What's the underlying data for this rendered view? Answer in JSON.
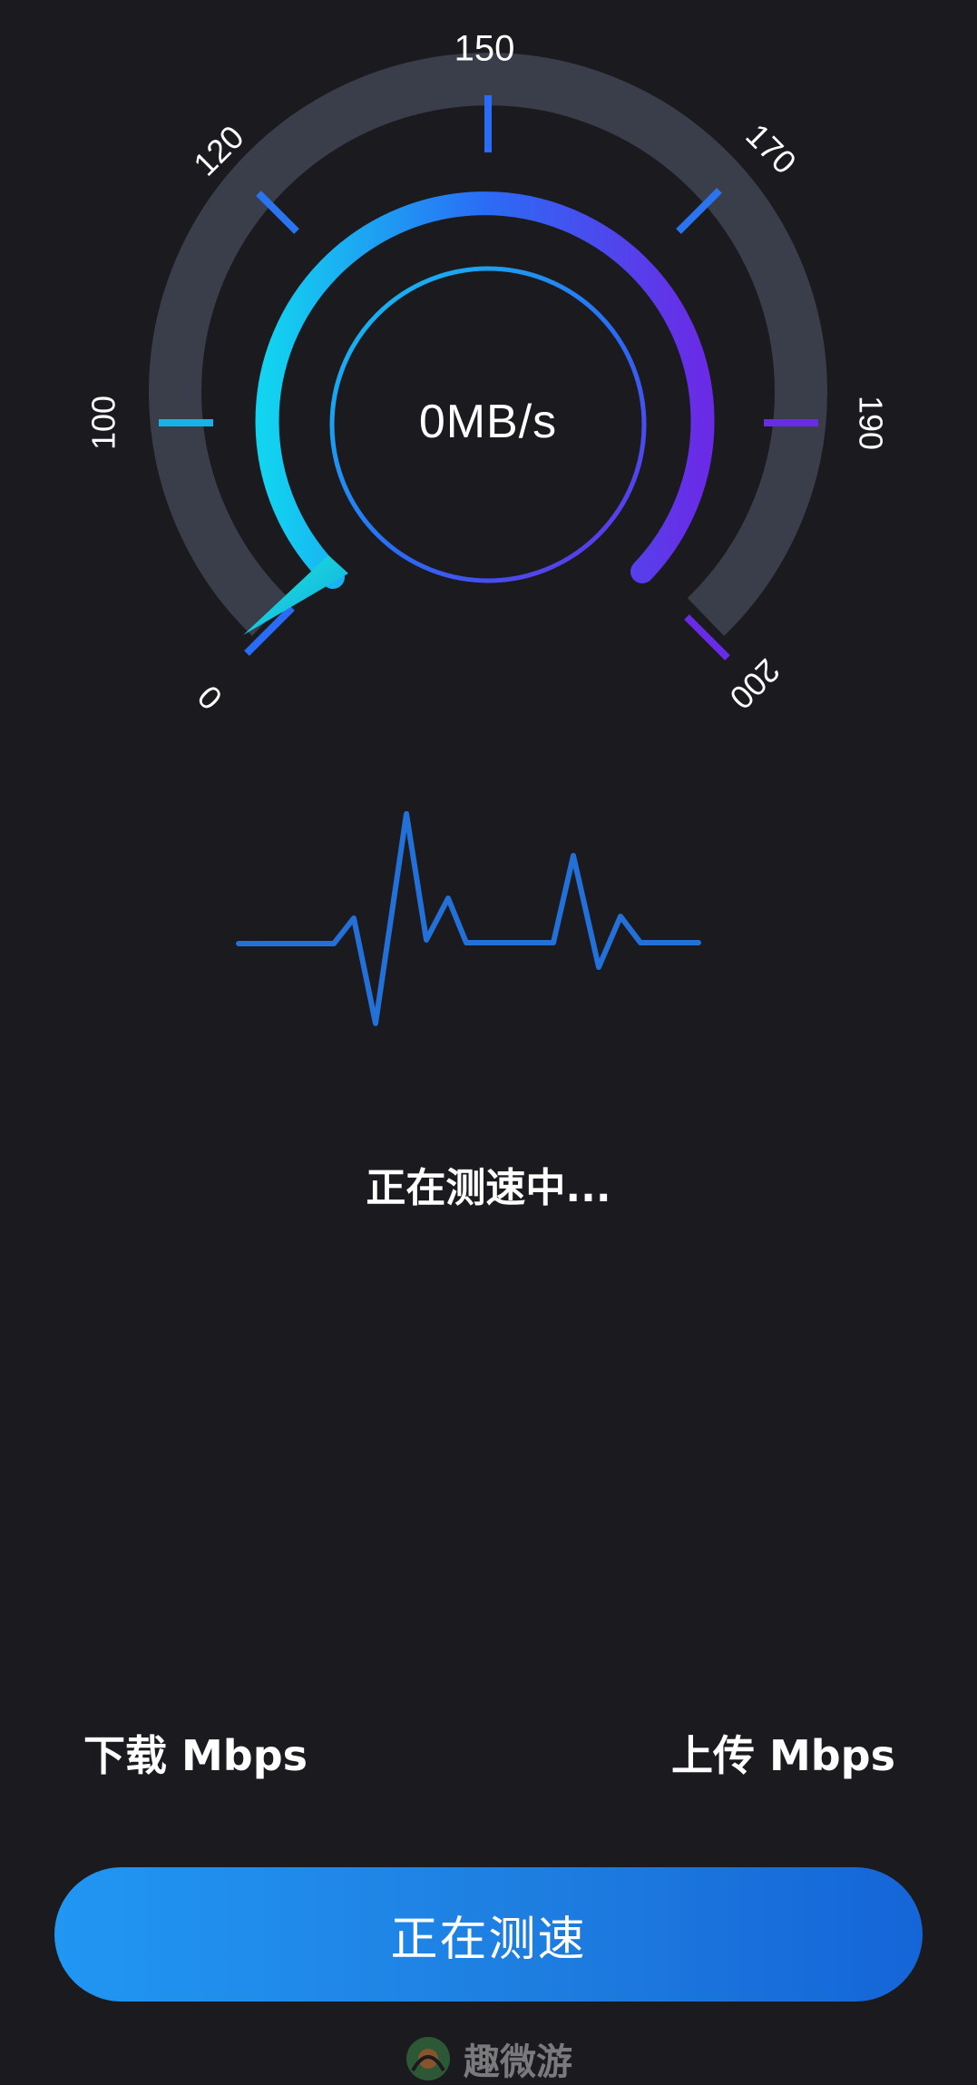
{
  "gauge": {
    "readout": "0MB/s",
    "current_value": 0,
    "tick_labels": [
      "0",
      "100",
      "120",
      "150",
      "170",
      "190",
      "200"
    ],
    "colors": {
      "track": "#3a3d4a",
      "gradient_start": "#12d3f0",
      "gradient_mid": "#2a6cf5",
      "gradient_end": "#6a2be6",
      "tick_low": "#17b2e8",
      "tick_mid": "#2a74f0",
      "tick_high": "#6a2be6"
    }
  },
  "status": {
    "text": "正在测速中..."
  },
  "metrics": {
    "download_label": "下载 Mbps",
    "upload_label": "上传 Mbps"
  },
  "action_button": {
    "label": "正在测速"
  },
  "watermark": {
    "text": "趣微游"
  }
}
